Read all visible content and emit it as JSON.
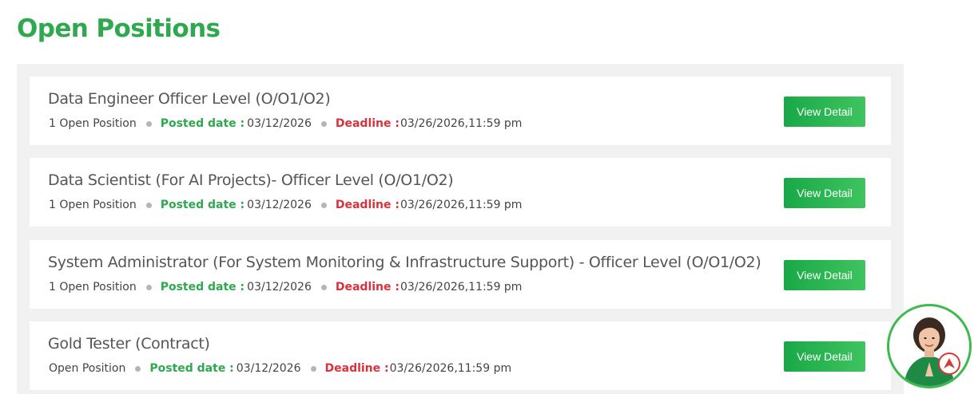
{
  "page": {
    "title": "Open Positions"
  },
  "jobs": [
    {
      "title": "Data Engineer Officer Level (O/O1/O2)",
      "openings": "1 Open Position",
      "posted_label": "Posted date :",
      "posted_date": "03/12/2026",
      "deadline_label": "Deadline :",
      "deadline": "03/26/2026,11:59 pm",
      "button_label": "View Detail"
    },
    {
      "title": "Data Scientist (For AI Projects)- Officer Level (O/O1/O2)",
      "openings": "1 Open Position",
      "posted_label": "Posted date :",
      "posted_date": "03/12/2026",
      "deadline_label": "Deadline :",
      "deadline": "03/26/2026,11:59 pm",
      "button_label": "View Detail"
    },
    {
      "title": "System Administrator (For System Monitoring & Infrastructure Support) - Officer Level (O/O1/O2)",
      "openings": "1 Open Position",
      "posted_label": "Posted date :",
      "posted_date": "03/12/2026",
      "deadline_label": "Deadline :",
      "deadline": "03/26/2026,11:59 pm",
      "button_label": "View Detail"
    },
    {
      "title": "Gold Tester (Contract)",
      "openings": "Open Position",
      "posted_label": "Posted date :",
      "posted_date": "03/12/2026",
      "deadline_label": "Deadline :",
      "deadline": "03/26/2026,11:59 pm",
      "button_label": "View Detail"
    }
  ],
  "assistant": {
    "icon": "chat-assistant-avatar",
    "badge_icon": "brand-logo-icon"
  },
  "colors": {
    "title_green": "#2fa84f",
    "posted_green": "#2fa84f",
    "deadline_red": "#d9323c",
    "button_green": "#19a847",
    "panel_gray": "#f1f1f1"
  }
}
